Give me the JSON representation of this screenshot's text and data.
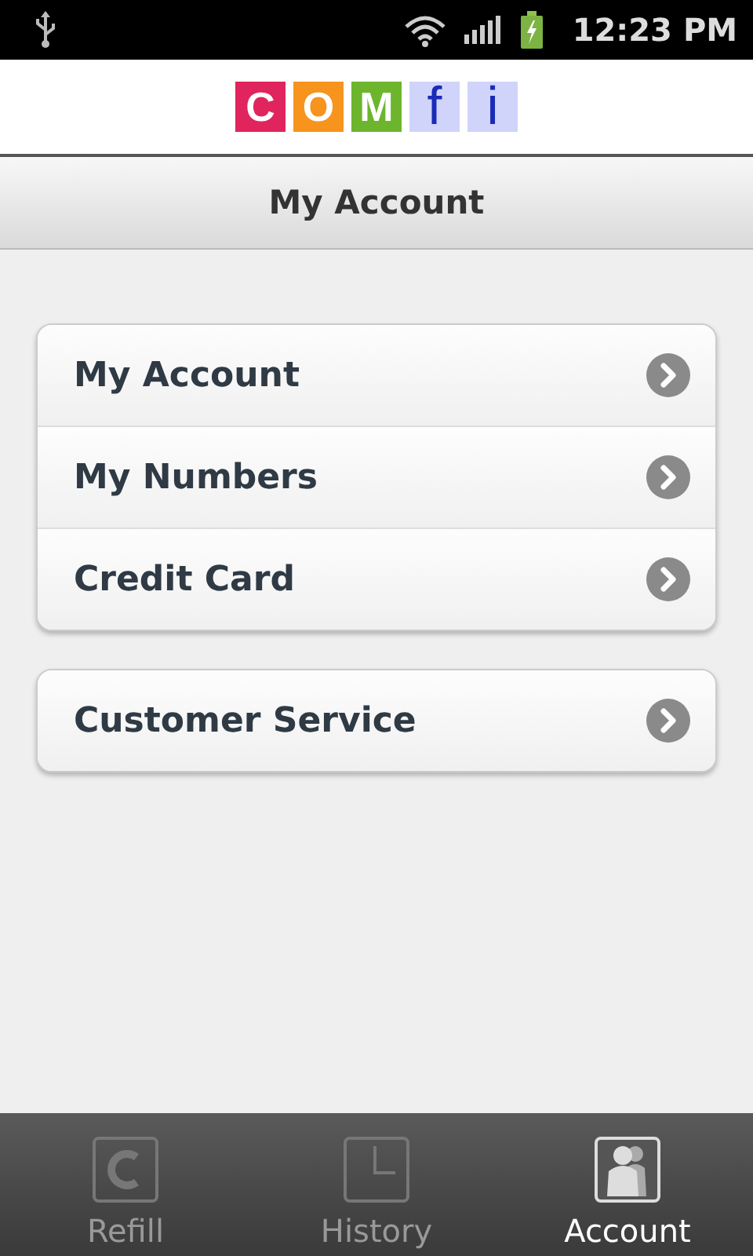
{
  "status_bar": {
    "time": "12:23 PM"
  },
  "logo": {
    "letters": [
      {
        "char": "C",
        "color": "#e0245e"
      },
      {
        "char": "O",
        "color": "#f7941d"
      },
      {
        "char": "M",
        "color": "#6cb52d"
      },
      {
        "char": "f",
        "color": "#d0d4fa"
      },
      {
        "char": "i",
        "color": "#d0d4fa"
      }
    ]
  },
  "title_bar": {
    "title": "My Account"
  },
  "menu_groups": [
    {
      "items": [
        {
          "label": "My Account"
        },
        {
          "label": "My Numbers"
        },
        {
          "label": "Credit Card"
        }
      ]
    },
    {
      "items": [
        {
          "label": "Customer Service"
        }
      ]
    }
  ],
  "tabs": [
    {
      "label": "Refill",
      "kind": "refill",
      "selected": false
    },
    {
      "label": "History",
      "kind": "history",
      "selected": false
    },
    {
      "label": "Account",
      "kind": "account",
      "selected": true
    }
  ]
}
